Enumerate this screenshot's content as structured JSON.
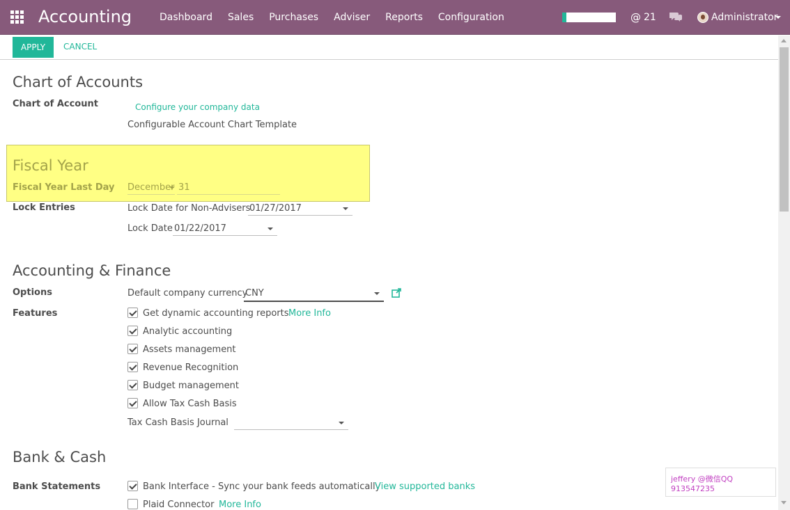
{
  "app": {
    "title": "Accounting",
    "menu": [
      "Dashboard",
      "Sales",
      "Purchases",
      "Adviser",
      "Reports",
      "Configuration"
    ],
    "progress_fraction": 0.08,
    "mentions_count": "21",
    "user_name": "Administrator",
    "accent_color": "#875a7b",
    "primary_color": "#21b799"
  },
  "toolbar": {
    "apply_label": "APPLY",
    "cancel_label": "CANCEL"
  },
  "chart_of_accounts": {
    "heading": "Chart of Accounts",
    "label": "Chart of Account",
    "configure_link": "Configure your company data",
    "template_text": "Configurable Account Chart Template"
  },
  "fiscal_year": {
    "heading": "Fiscal Year",
    "label": "Fiscal Year Last Day",
    "month": "December",
    "day": "31"
  },
  "lock_entries": {
    "label": "Lock Entries",
    "non_advisers_label": "Lock Date for Non-Advisers",
    "non_advisers_date": "01/27/2017",
    "lock_date_label": "Lock Date",
    "lock_date": "01/22/2017"
  },
  "accounting_finance": {
    "heading": "Accounting & Finance",
    "options_label": "Options",
    "currency_label": "Default company currency",
    "currency_value": "CNY",
    "features_label": "Features",
    "features": [
      {
        "label": "Get dynamic accounting reports",
        "checked": true,
        "link": "More Info"
      },
      {
        "label": "Analytic accounting",
        "checked": true
      },
      {
        "label": "Assets management",
        "checked": true
      },
      {
        "label": "Revenue Recognition",
        "checked": true
      },
      {
        "label": "Budget management",
        "checked": true
      },
      {
        "label": "Allow Tax Cash Basis",
        "checked": true
      }
    ],
    "tax_journal_label": "Tax Cash Basis Journal",
    "tax_journal_value": ""
  },
  "bank_cash": {
    "heading": "Bank & Cash",
    "statements_label": "Bank Statements",
    "items": [
      {
        "label": "Bank Interface - Sync your bank feeds automatically",
        "checked": true,
        "link": "View supported banks"
      },
      {
        "label": "Plaid Connector",
        "checked": false,
        "link": "More Info"
      }
    ]
  },
  "watermark": {
    "text": "jeffery @微信QQ 913547235"
  }
}
